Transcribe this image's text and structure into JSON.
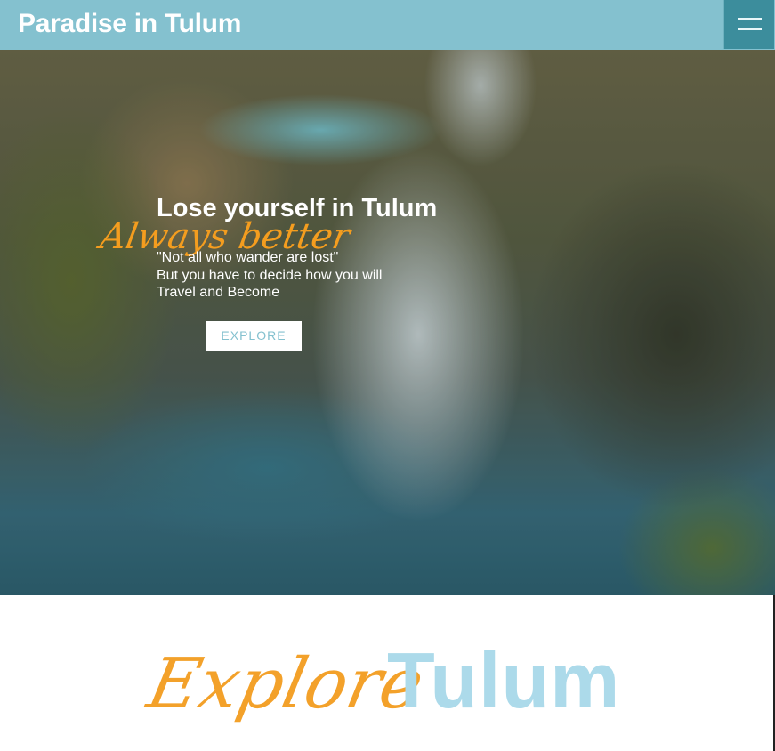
{
  "header": {
    "title": "Paradise in Tulum",
    "menu_icon": "hamburger-menu-icon",
    "background": "#84c1cf",
    "menu_background": "#3c8d9c"
  },
  "hero": {
    "heading": "Lose yourself in Tulum",
    "script_text": "Always better",
    "quote_lines": [
      "\"Not all who wander are lost\"",
      "But you have to decide how you will",
      "Travel and Become"
    ],
    "button_label": "EXPLORE",
    "accent_color": "#f49d1f"
  },
  "section": {
    "script_word": "Explore",
    "bold_word": "Tulum",
    "script_color": "#f3a12a",
    "bold_color": "#acdaea"
  }
}
